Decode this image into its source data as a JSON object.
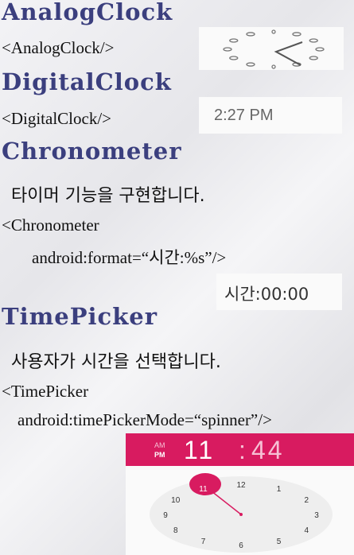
{
  "sections": {
    "analog": {
      "title": "AnalogClock",
      "code": "<AnalogClock/>"
    },
    "digital": {
      "title": "DigitalClock",
      "code": "<DigitalClock/>",
      "display": "2:27 PM"
    },
    "chrono": {
      "title": "Chronometer",
      "desc": "타이머 기능을 구현합니다.",
      "code1": "<Chronometer",
      "code2": "android:format=“시간:%s”/>",
      "display": "시간:00:00"
    },
    "timepicker": {
      "title": "TimePicker",
      "desc": "사용자가 시간을 선택합니다.",
      "code1": "<TimePicker",
      "code2": "android:timePickerMode=“spinner”/>",
      "am": "AM",
      "pm": "PM",
      "hour": "11",
      "sep": ":",
      "minute": "44",
      "numbers": [
        "12",
        "1",
        "2",
        "3",
        "4",
        "5",
        "6",
        "7",
        "8",
        "9",
        "10",
        "11"
      ]
    }
  },
  "colors": {
    "title": "#3b3f7e",
    "accent": "#d81b60"
  }
}
